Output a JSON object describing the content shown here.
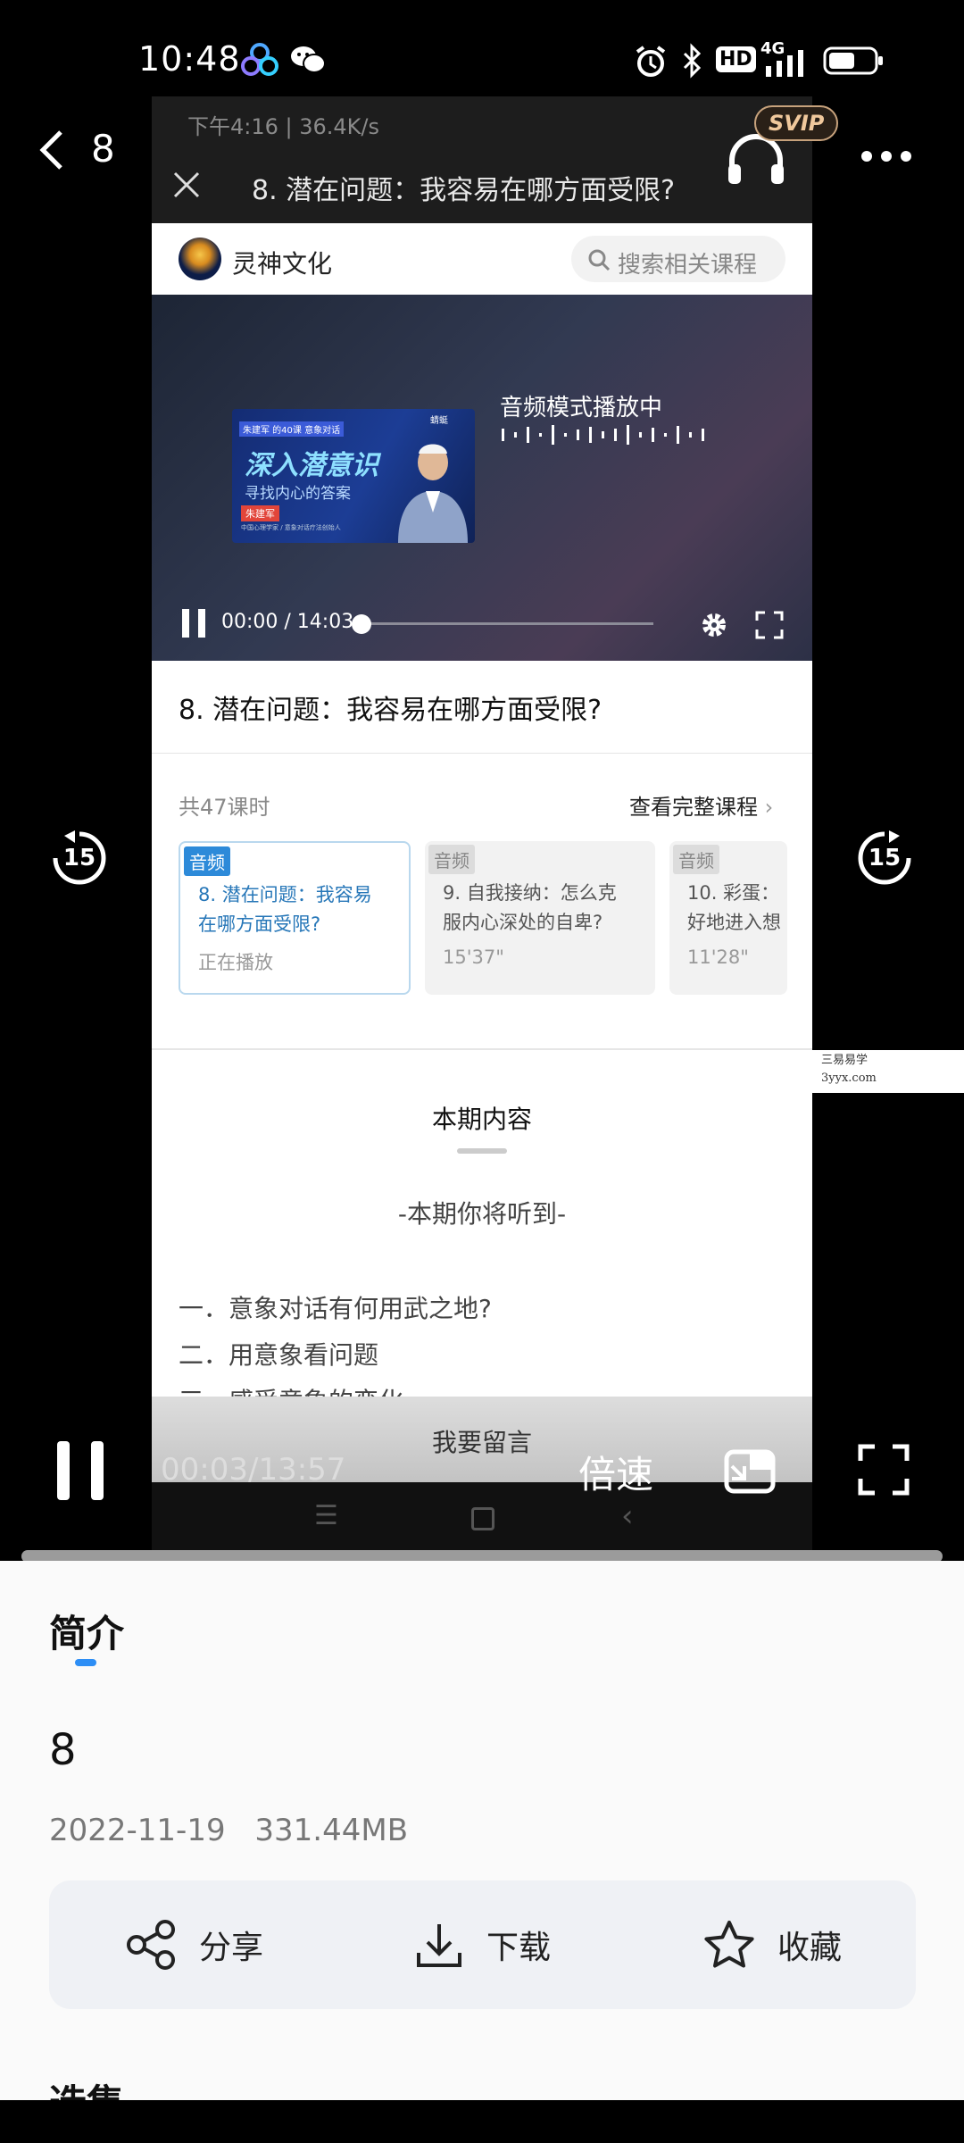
{
  "status_bar": {
    "time": "10:48",
    "hd": "HD",
    "network": "4G"
  },
  "player_header": {
    "back_title": "8",
    "svip_badge": "SVIP"
  },
  "inner_screen": {
    "status_time": "下午4:16 | 36.4K/s",
    "title": "8. 潜在问题：我容易在哪方面受限?",
    "brand_name": "灵神文化",
    "search_placeholder": "搜索相关课程",
    "video": {
      "poster_tag": "朱建军 的40课 意象对话",
      "poster_heading": "深入潜意识",
      "poster_sub": "寻找内心的答案",
      "poster_name": "朱建军",
      "poster_caption": "中国心理学家 / 意象对话疗法创始人",
      "poster_logo": "蜻蜓",
      "audio_mode": "音频模式播放中",
      "time": "00:00 / 14:03"
    },
    "lesson_title": "8. 潜在问题：我容易在哪方面受限?",
    "lesson_count": "共47课时",
    "view_full": "查看完整课程",
    "cards": [
      {
        "tag": "音频",
        "line1": "8. 潜在问题：我容易",
        "line2": "在哪方面受限?",
        "sub": "正在播放",
        "active": true
      },
      {
        "tag": "音频",
        "line1": "9. 自我接纳：怎么克",
        "line2": "服内心深处的自卑?",
        "sub": "15'37\"",
        "active": false
      },
      {
        "tag": "音频",
        "line1": "10. 彩蛋：",
        "line2": "好地进入想",
        "sub": "11'28\"",
        "active": false
      }
    ],
    "section_title": "本期内容",
    "intro": "-本期你将听到-",
    "items": [
      "一．意象对话有何用武之地?",
      "二．用意象看问题",
      "三．感受意象的变化"
    ],
    "leave_message": "我要留言"
  },
  "watermark": {
    "line1": "三易易学",
    "line2": "3yyx.com"
  },
  "controls": {
    "current_time": "00:03/13:57",
    "speed_label": "倍速",
    "skip_back": "15",
    "skip_forward": "15",
    "progress": 0.0
  },
  "sheet": {
    "tab": "简介",
    "file_name": "8",
    "meta_date": "2022-11-19",
    "meta_size": "331.44MB",
    "share": "分享",
    "download": "下载",
    "favorite": "收藏",
    "next_heading": "选集"
  }
}
